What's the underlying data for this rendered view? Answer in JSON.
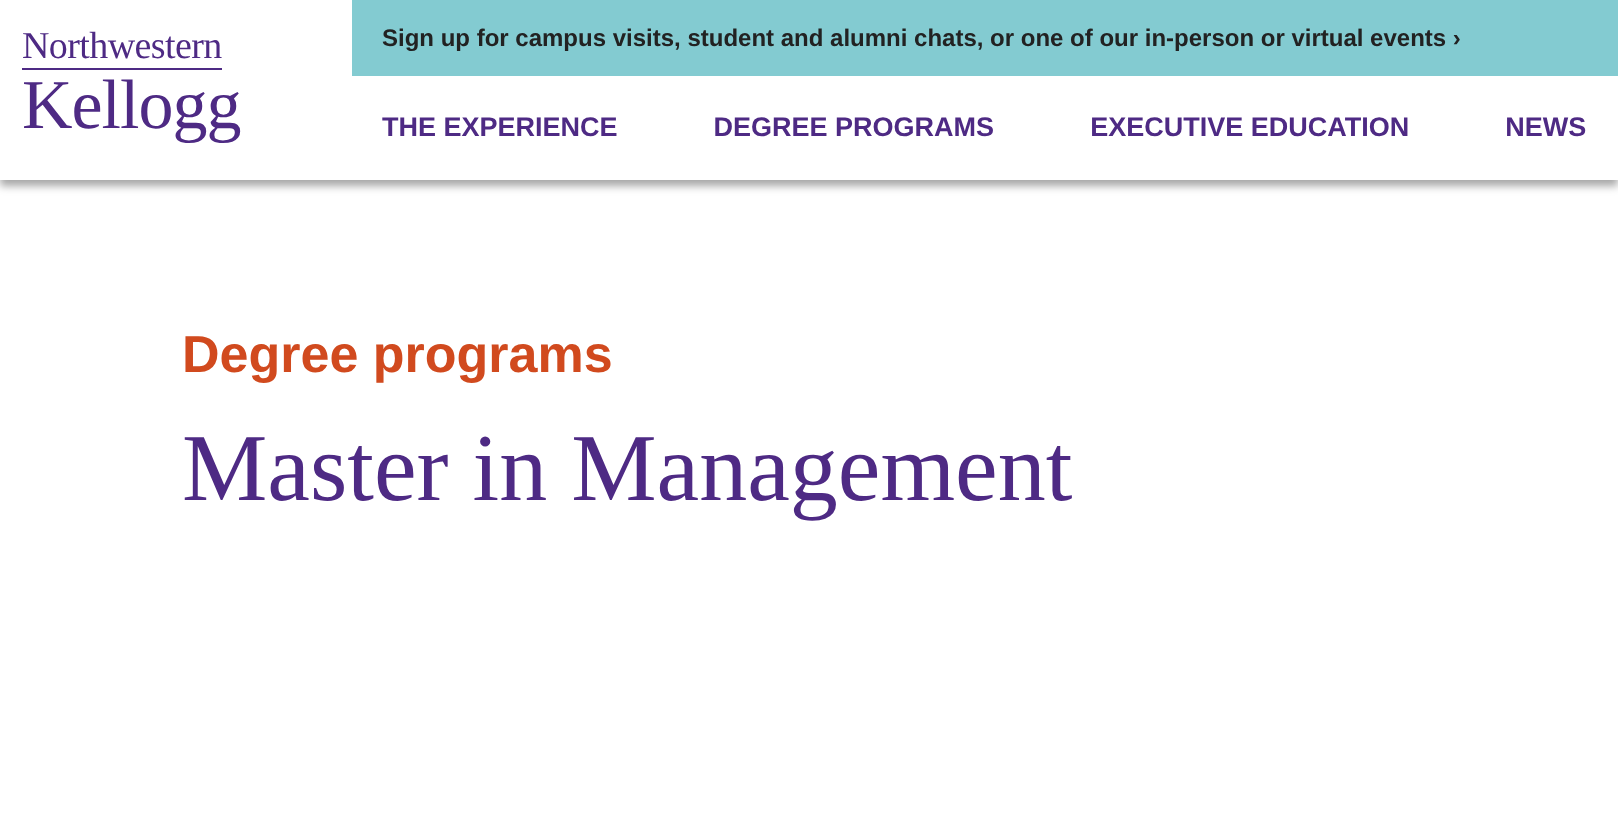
{
  "logo": {
    "top": "Northwestern",
    "bottom": "Kellogg"
  },
  "banner": {
    "text": "Sign up for campus visits, student and alumni chats, or one of our in-person or virtual events ›"
  },
  "nav": [
    "THE EXPERIENCE",
    "DEGREE PROGRAMS",
    "EXECUTIVE EDUCATION",
    "NEWS"
  ],
  "eyebrow": "Degree programs",
  "title": "Master in Management"
}
